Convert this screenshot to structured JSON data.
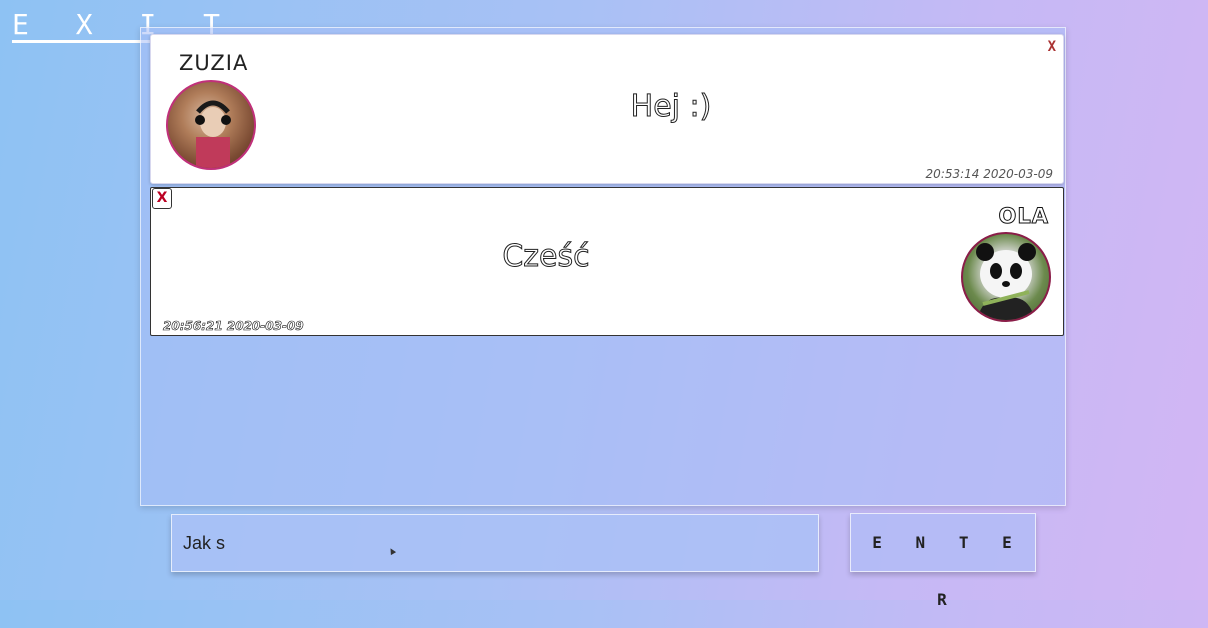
{
  "header": {
    "exit_label": "E X I T"
  },
  "messages": [
    {
      "sender": "ZUZIA",
      "text": "Hej :)",
      "timestamp": "20:53:14 2020-03-09",
      "close_label": "X",
      "avatar": "photo-avatar-zuzia"
    },
    {
      "sender": "OLA",
      "text": "Cześć",
      "timestamp": "20:56:21 2020-03-09",
      "close_label": "X",
      "avatar": "photo-avatar-panda"
    }
  ],
  "composer": {
    "input_value": "Jak s",
    "enter_label": "E N T E R"
  },
  "colors": {
    "accent_border": "#c0307a",
    "close_red": "#a33"
  }
}
